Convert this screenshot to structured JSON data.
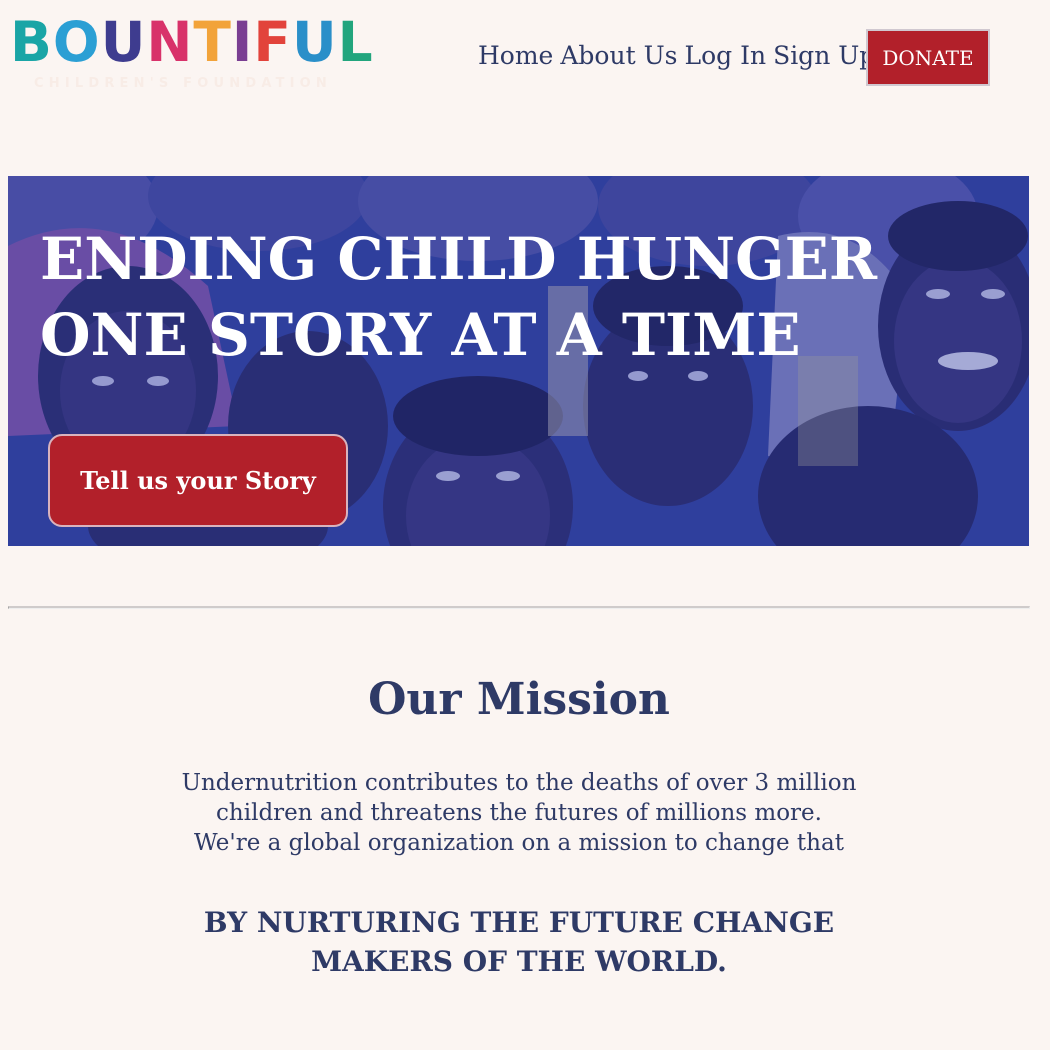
{
  "logo": {
    "letters": [
      {
        "char": "B",
        "color": "#1aa5a6"
      },
      {
        "char": "O",
        "color": "#2b9fd4"
      },
      {
        "char": "U",
        "color": "#3e3c8f"
      },
      {
        "char": "N",
        "color": "#d8326a"
      },
      {
        "char": "T",
        "color": "#f2a33a"
      },
      {
        "char": "I",
        "color": "#7a3e92"
      },
      {
        "char": "F",
        "color": "#e2433b"
      },
      {
        "char": "U",
        "color": "#2a8fc9"
      },
      {
        "char": "L",
        "color": "#22a57d"
      }
    ],
    "subtitle": "CHILDREN'S FOUNDATION"
  },
  "nav": {
    "items": [
      "Home",
      "About Us",
      "Log In",
      "Sign Up"
    ],
    "donate_label": "DONATE"
  },
  "hero": {
    "title_line1": "ENDING CHILD HUNGER",
    "title_line2": "ONE STORY AT A TIME",
    "cta_label": "Tell us your Story"
  },
  "mission": {
    "title": "Our Mission",
    "text_line1": "Undernutrition contributes to the deaths of over 3 million",
    "text_line2": "children and threatens the futures of millions more.",
    "text_line3": "We're a global organization on a mission to change that",
    "tagline_line1": "BY NURTURING THE FUTURE CHANGE",
    "tagline_line2": "MAKERS OF THE WORLD."
  },
  "colors": {
    "background": "#fbf5f2",
    "navy_text": "#2e3a66",
    "accent_red": "#b2202a",
    "hero_tint": "#2f3d94"
  }
}
